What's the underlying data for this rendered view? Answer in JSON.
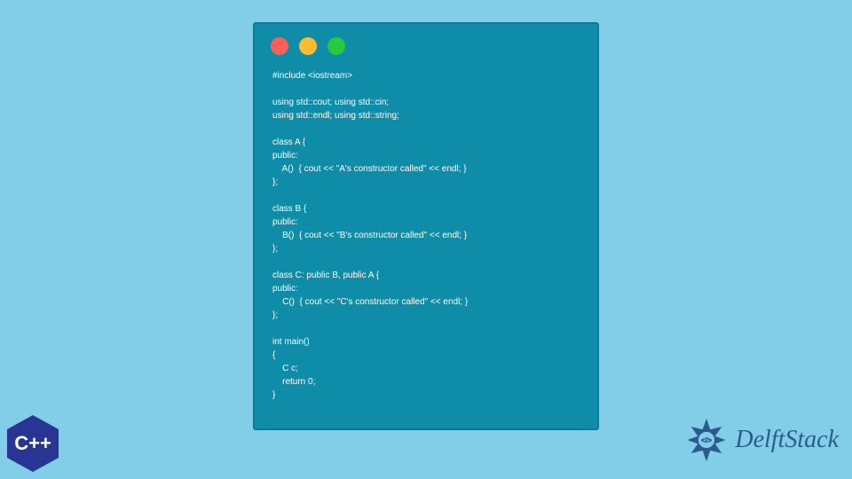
{
  "window": {
    "dots": [
      "red",
      "yellow",
      "green"
    ]
  },
  "code": "#include <iostream>\n\nusing std::cout; using std::cin;\nusing std::endl; using std::string;\n\nclass A {\npublic:\n    A()  { cout << \"A's constructor called\" << endl; }\n};\n\nclass B {\npublic:\n    B()  { cout << \"B's constructor called\" << endl; }\n};\n\nclass C: public B, public A {\npublic:\n    C()  { cout << \"C's constructor called\" << endl; }\n};\n\nint main()\n{\n    C c;\n    return 0;\n}",
  "cppLogo": {
    "text": "C++"
  },
  "delftLogo": {
    "text": "DelftStack"
  }
}
